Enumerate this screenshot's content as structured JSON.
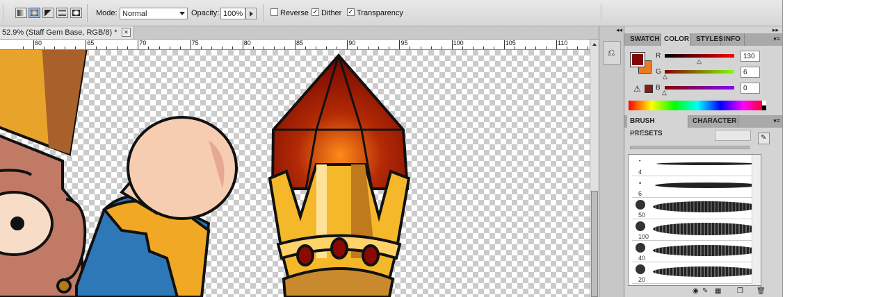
{
  "options_bar": {
    "mode_label": "Mode:",
    "mode_value": "Normal",
    "opacity_label": "Opacity:",
    "opacity_value": "100%",
    "reverse_label": "Reverse",
    "reverse_checked": false,
    "dither_label": "Dither",
    "dither_checked": true,
    "transparency_label": "Transparency",
    "transparency_checked": true,
    "gradient_types": [
      "linear-gradient-icon",
      "radial-gradient-icon",
      "angle-gradient-icon",
      "reflected-gradient-icon",
      "diamond-gradient-icon"
    ],
    "selected_gradient_index": 1
  },
  "document": {
    "tab_title": "52.9% (Staff Gem Base, RGB/8) *",
    "close_glyph": "✕"
  },
  "ruler": {
    "labels": [
      "60",
      "65",
      "70",
      "75",
      "80",
      "85",
      "90",
      "95",
      "100",
      "105",
      "110"
    ]
  },
  "color_panel": {
    "tabs": [
      "SWATCH",
      "COLOR",
      "STYLES",
      "INFO"
    ],
    "active_tab": "COLOR",
    "foreground_color": "#820606",
    "background_color": "#ef7a1a",
    "channels": [
      {
        "label": "R",
        "value": "130"
      },
      {
        "label": "G",
        "value": "6"
      },
      {
        "label": "B",
        "value": "0"
      }
    ],
    "gamut_warning_icon": "warning-icon"
  },
  "brush_panel": {
    "tabs": [
      "BRUSH PRESETS",
      "CHARACTER"
    ],
    "active_tab": "BRUSH PRESETS",
    "size_label": "Size:",
    "brush_sizes": [
      "4",
      "6",
      "50",
      "100",
      "40",
      "20"
    ],
    "footer_icons": [
      "eye-icon",
      "brush-tool-icon",
      "grid-icon",
      "new-preset-icon",
      "trash-icon"
    ]
  },
  "colors": {
    "accent_selected": "#9fb3d6",
    "panel_bg": "#d4d4d4"
  }
}
